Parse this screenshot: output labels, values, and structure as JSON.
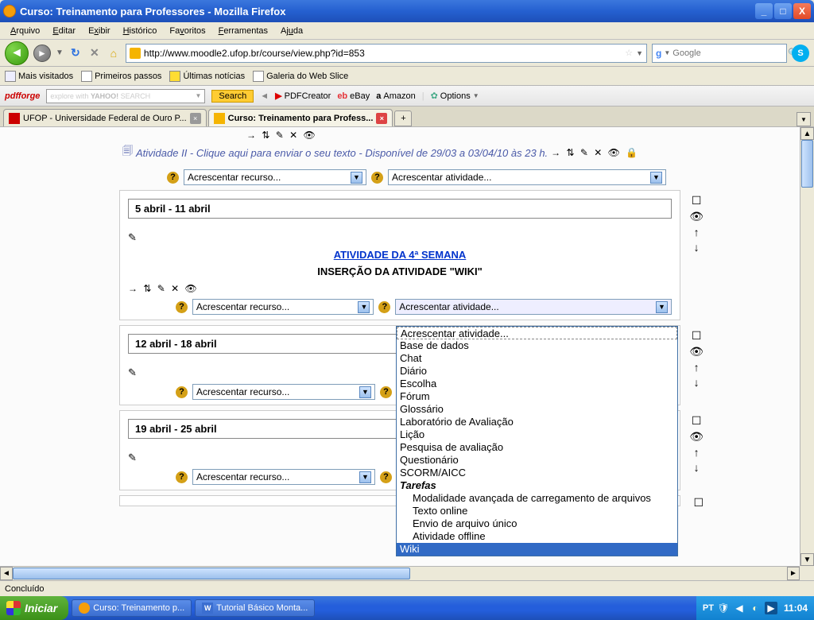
{
  "window": {
    "title": "Curso: Treinamento para Professores - Mozilla Firefox"
  },
  "menu": {
    "arquivo": "Arquivo",
    "editar": "Editar",
    "exibir": "Exibir",
    "historico": "Histórico",
    "favoritos": "Favoritos",
    "ferramentas": "Ferramentas",
    "ajuda": "Ajuda"
  },
  "nav": {
    "url": "http://www.moodle2.ufop.br/course/view.php?id=853",
    "search_placeholder": "Google"
  },
  "bookmarks": {
    "b1": "Mais visitados",
    "b2": "Primeiros passos",
    "b3": "Últimas notícias",
    "b4": "Galeria do Web Slice"
  },
  "pdfbar": {
    "logo": "pdfforge",
    "explore": "explore with",
    "ytext": "YAHOO! SEARCH",
    "search": "Search",
    "pdfc": "PDFCreator",
    "ebay": "eBay",
    "amazon": "Amazon",
    "options": "Options"
  },
  "tabs": {
    "t1": "UFOP - Universidade Federal de Ouro P...",
    "t2": "Curso: Treinamento para Profess..."
  },
  "moodle": {
    "atividade2_label": "Atividade II - Clique aqui para enviar o seu texto - Disponível de 29/03 a 03/04/10 às 23 h.",
    "add_resource": "Acrescentar recurso...",
    "add_activity": "Acrescentar atividade...",
    "w3_title": "5 abril - 11 abril",
    "w3_head": "ATIVIDADE DA 4ª SEMANA",
    "w3_sub": "INSERÇÃO DA ATIVIDADE \"WIKI\"",
    "w4_title": "12 abril - 18 abril",
    "w5_title": "19 abril - 25 abril"
  },
  "dropdown": {
    "o0": "Acrescentar atividade...",
    "o1": "Base de dados",
    "o2": "Chat",
    "o3": "Diário",
    "o4": "Escolha",
    "o5": "Fórum",
    "o6": "Glossário",
    "o7": "Laboratório de Avaliação",
    "o8": "Lição",
    "o9": "Pesquisa de avaliação",
    "o10": "Questionário",
    "o11": "SCORM/AICC",
    "o12": "Tarefas",
    "o13": "Modalidade avançada de carregamento de arquivos",
    "o14": "Texto online",
    "o15": "Envio de arquivo único",
    "o16": "Atividade offline",
    "o17": "Wiki"
  },
  "status": {
    "text": "Concluído"
  },
  "taskbar": {
    "start": "Iniciar",
    "t1": "Curso: Treinamento p...",
    "t2": "Tutorial Básico Monta...",
    "lang": "PT",
    "clock": "11:04"
  }
}
